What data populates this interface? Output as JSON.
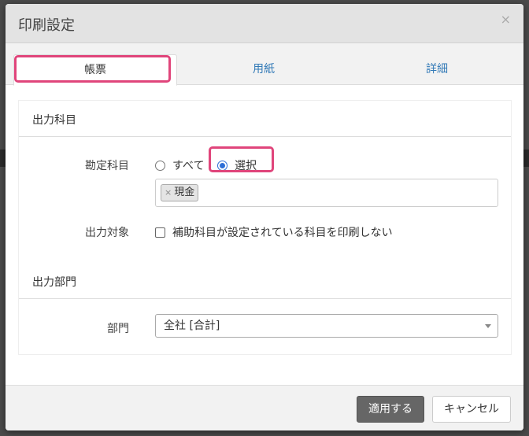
{
  "dialog": {
    "title": "印刷設定",
    "close_symbol": "×"
  },
  "tabs": [
    {
      "label": "帳票",
      "active": true
    },
    {
      "label": "用紙",
      "active": false
    },
    {
      "label": "詳細",
      "active": false
    }
  ],
  "output_accounts": {
    "section_title": "出力科目",
    "account_label": "勘定科目",
    "radio_all_label": "すべて",
    "radio_select_label": "選択",
    "selected_value": "選択",
    "tags": [
      {
        "remove_symbol": "×",
        "label": "現金"
      }
    ],
    "target_label": "出力対象",
    "checkbox_label": "補助科目が設定されている科目を印刷しない",
    "checkbox_checked": false
  },
  "output_department": {
    "section_title": "出力部門",
    "department_label": "部門",
    "department_value": "全社 [合計]"
  },
  "footer": {
    "apply_label": "適用する",
    "cancel_label": "キャンセル"
  },
  "colors": {
    "highlight": "#e0457b",
    "tab_link": "#337ab7",
    "radio_accent": "#2f6fd6",
    "primary_button": "#666666"
  }
}
